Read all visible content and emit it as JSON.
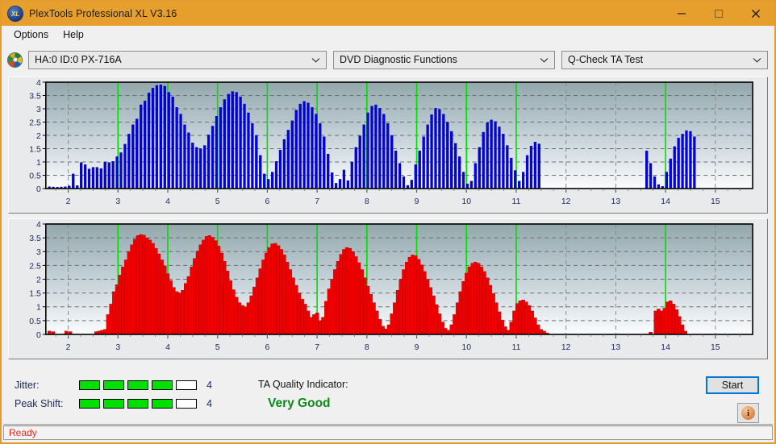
{
  "window": {
    "title": "PlexTools Professional XL V3.16",
    "app_icon": "xl-disc-icon",
    "minimize_label": "minimize-icon",
    "maximize_label": "maximize-icon",
    "close_label": "close-icon"
  },
  "menu": {
    "items": [
      {
        "label": "Options"
      },
      {
        "label": "Help"
      }
    ]
  },
  "selectors": {
    "drive_icon": "disc-drive-icon",
    "drive": "HA:0 ID:0  PX-716A",
    "function": "DVD Diagnostic Functions",
    "test": "Q-Check TA Test"
  },
  "meters": {
    "jitter": {
      "label": "Jitter:",
      "value": "4",
      "filled": 4,
      "total": 5
    },
    "peak_shift": {
      "label": "Peak Shift:",
      "value": "4",
      "filled": 4,
      "total": 5
    },
    "on_color": "#00e000"
  },
  "quality": {
    "label": "TA Quality Indicator:",
    "value": "Very Good",
    "value_color": "#0a8a18"
  },
  "actions": {
    "start_label": "Start",
    "info_label": "i"
  },
  "statusbar": {
    "text": "Ready",
    "text_color": "#e02b20"
  },
  "chart_data": [
    {
      "id": "jitter",
      "type": "bar",
      "title": "",
      "xlabel": "",
      "ylabel": "",
      "series_color": "#0000ee",
      "bar_edge_color": "#000080",
      "xlim": [
        1.55,
        15.75
      ],
      "ylim": [
        0,
        4
      ],
      "yticks": [
        0,
        0.5,
        1,
        1.5,
        2,
        2.5,
        3,
        3.5,
        4
      ],
      "ytick_labels": [
        "0",
        "0.5",
        "1",
        "1.5",
        "2",
        "2.5",
        "3",
        "3.5",
        "4"
      ],
      "xticks": [
        2,
        3,
        4,
        5,
        6,
        7,
        8,
        9,
        10,
        11,
        12,
        13,
        14,
        15
      ],
      "xtick_labels": [
        "2",
        "3",
        "4",
        "5",
        "6",
        "7",
        "8",
        "9",
        "10",
        "11",
        "12",
        "13",
        "14",
        "15"
      ],
      "grid": true,
      "marker_color": "#00dd00",
      "markers": [
        3,
        4,
        5,
        6,
        7,
        8,
        9,
        10,
        11,
        14
      ],
      "bar_gap_ratio": 0.42,
      "x": [
        1.62,
        1.7,
        1.78,
        1.86,
        1.94,
        2.02,
        2.1,
        2.18,
        2.26,
        2.34,
        2.42,
        2.5,
        2.58,
        2.66,
        2.74,
        2.82,
        2.9,
        2.98,
        3.06,
        3.14,
        3.22,
        3.3,
        3.38,
        3.46,
        3.54,
        3.62,
        3.7,
        3.78,
        3.86,
        3.94,
        4.02,
        4.1,
        4.18,
        4.26,
        4.34,
        4.42,
        4.5,
        4.58,
        4.66,
        4.74,
        4.82,
        4.9,
        4.98,
        5.06,
        5.14,
        5.22,
        5.3,
        5.38,
        5.46,
        5.54,
        5.62,
        5.7,
        5.78,
        5.86,
        5.94,
        6.02,
        6.1,
        6.18,
        6.26,
        6.34,
        6.42,
        6.5,
        6.58,
        6.66,
        6.74,
        6.82,
        6.9,
        6.98,
        7.06,
        7.14,
        7.22,
        7.3,
        7.38,
        7.46,
        7.54,
        7.62,
        7.7,
        7.78,
        7.86,
        7.94,
        8.02,
        8.1,
        8.18,
        8.26,
        8.34,
        8.42,
        8.5,
        8.58,
        8.66,
        8.74,
        8.82,
        8.9,
        8.98,
        9.06,
        9.14,
        9.22,
        9.3,
        9.38,
        9.46,
        9.54,
        9.62,
        9.7,
        9.78,
        9.86,
        9.94,
        10.02,
        10.1,
        10.18,
        10.26,
        10.34,
        10.42,
        10.5,
        10.58,
        10.66,
        10.74,
        10.82,
        10.9,
        10.98,
        11.06,
        11.14,
        11.22,
        11.3,
        11.38,
        11.46,
        13.62,
        13.7,
        13.78,
        13.86,
        13.94,
        14.02,
        14.1,
        14.18,
        14.26,
        14.34,
        14.42,
        14.5,
        14.58
      ],
      "values": [
        0.07,
        0.06,
        0.05,
        0.06,
        0.07,
        0.1,
        0.55,
        0.11,
        0.98,
        0.9,
        0.74,
        0.8,
        0.8,
        0.75,
        1.0,
        0.98,
        1.02,
        1.2,
        1.35,
        1.67,
        2.05,
        2.4,
        2.62,
        3.15,
        3.3,
        3.6,
        3.78,
        3.88,
        3.9,
        3.85,
        3.62,
        3.45,
        3.05,
        2.8,
        2.4,
        2.1,
        1.72,
        1.55,
        1.5,
        1.62,
        2.02,
        2.35,
        2.72,
        3.05,
        3.35,
        3.55,
        3.65,
        3.62,
        3.45,
        3.18,
        2.85,
        2.45,
        2.0,
        1.25,
        0.55,
        0.35,
        0.62,
        1.02,
        1.45,
        1.85,
        2.2,
        2.55,
        2.95,
        3.18,
        3.28,
        3.22,
        3.05,
        2.8,
        2.45,
        1.95,
        1.3,
        0.6,
        0.2,
        0.35,
        0.7,
        0.3,
        1.0,
        1.55,
        1.98,
        2.4,
        2.85,
        3.1,
        3.15,
        3.02,
        2.8,
        2.45,
        2.0,
        1.42,
        0.95,
        0.45,
        0.12,
        0.32,
        0.9,
        1.42,
        1.95,
        2.4,
        2.78,
        3.02,
        2.98,
        2.8,
        2.5,
        2.15,
        1.7,
        1.2,
        0.62,
        0.18,
        0.28,
        0.95,
        1.55,
        2.12,
        2.48,
        2.58,
        2.52,
        2.32,
        2.05,
        1.62,
        1.15,
        0.68,
        0.28,
        0.62,
        1.25,
        1.6,
        1.75,
        1.68,
        1.42,
        0.95,
        0.45,
        0.15,
        0.08,
        0.62,
        1.12,
        1.58,
        1.9,
        2.05,
        2.18,
        2.15,
        1.95,
        1.55,
        0.95,
        0.35,
        0.1
      ]
    },
    {
      "id": "peak_shift",
      "type": "bar",
      "title": "",
      "xlabel": "",
      "ylabel": "",
      "series_color": "#ee0000",
      "bar_edge_color": "#aa0000",
      "xlim": [
        1.55,
        15.75
      ],
      "ylim": [
        0,
        4
      ],
      "yticks": [
        0,
        0.5,
        1,
        1.5,
        2,
        2.5,
        3,
        3.5,
        4
      ],
      "ytick_labels": [
        "0",
        "0.5",
        "1",
        "1.5",
        "2",
        "2.5",
        "3",
        "3.5",
        "4"
      ],
      "xticks": [
        2,
        3,
        4,
        5,
        6,
        7,
        8,
        9,
        10,
        11,
        12,
        13,
        14,
        15
      ],
      "xtick_labels": [
        "2",
        "3",
        "4",
        "5",
        "6",
        "7",
        "8",
        "9",
        "10",
        "11",
        "12",
        "13",
        "14",
        "15"
      ],
      "grid": true,
      "marker_color": "#00dd00",
      "markers": [
        3,
        4,
        5,
        6,
        7,
        8,
        9,
        10,
        11,
        14
      ],
      "bar_gap_ratio": 0.18,
      "x": [
        1.62,
        1.7,
        1.96,
        2.04,
        2.56,
        2.62,
        2.68,
        2.74,
        2.8,
        2.86,
        2.92,
        2.98,
        3.04,
        3.1,
        3.16,
        3.22,
        3.28,
        3.34,
        3.4,
        3.46,
        3.52,
        3.58,
        3.64,
        3.7,
        3.76,
        3.82,
        3.88,
        3.94,
        4.0,
        4.06,
        4.12,
        4.18,
        4.24,
        4.3,
        4.36,
        4.42,
        4.48,
        4.54,
        4.6,
        4.66,
        4.72,
        4.78,
        4.84,
        4.9,
        4.96,
        5.02,
        5.08,
        5.14,
        5.2,
        5.26,
        5.32,
        5.38,
        5.44,
        5.5,
        5.56,
        5.62,
        5.68,
        5.74,
        5.8,
        5.86,
        5.92,
        5.98,
        6.04,
        6.1,
        6.16,
        6.22,
        6.28,
        6.34,
        6.4,
        6.46,
        6.52,
        6.58,
        6.64,
        6.7,
        6.76,
        6.82,
        6.88,
        6.94,
        7.0,
        7.06,
        7.12,
        7.18,
        7.24,
        7.3,
        7.36,
        7.42,
        7.48,
        7.54,
        7.6,
        7.66,
        7.72,
        7.78,
        7.84,
        7.9,
        7.96,
        8.02,
        8.08,
        8.14,
        8.2,
        8.26,
        8.32,
        8.38,
        8.44,
        8.5,
        8.56,
        8.62,
        8.68,
        8.74,
        8.8,
        8.86,
        8.92,
        8.98,
        9.04,
        9.1,
        9.16,
        9.22,
        9.28,
        9.34,
        9.4,
        9.46,
        9.52,
        9.58,
        9.64,
        9.7,
        9.76,
        9.82,
        9.88,
        9.94,
        10.0,
        10.06,
        10.12,
        10.18,
        10.24,
        10.3,
        10.36,
        10.42,
        10.48,
        10.54,
        10.6,
        10.66,
        10.72,
        10.78,
        10.84,
        10.9,
        10.96,
        11.02,
        11.08,
        11.14,
        11.2,
        11.26,
        11.32,
        11.38,
        11.44,
        11.5,
        11.56,
        11.62,
        13.7,
        13.8,
        13.86,
        13.92,
        13.98,
        14.04,
        14.1,
        14.16,
        14.22,
        14.28,
        14.34,
        14.4,
        14.46,
        14.52
      ],
      "values": [
        0.12,
        0.1,
        0.12,
        0.1,
        0.1,
        0.12,
        0.15,
        0.18,
        0.72,
        1.1,
        1.55,
        1.8,
        2.15,
        2.45,
        2.7,
        3.0,
        3.25,
        3.45,
        3.58,
        3.62,
        3.6,
        3.5,
        3.42,
        3.3,
        3.12,
        2.92,
        2.7,
        2.48,
        2.2,
        1.95,
        1.7,
        1.55,
        1.5,
        1.6,
        1.85,
        2.1,
        2.45,
        2.75,
        3.02,
        3.25,
        3.42,
        3.55,
        3.58,
        3.52,
        3.4,
        3.2,
        2.95,
        2.65,
        2.3,
        1.95,
        1.62,
        1.35,
        1.15,
        1.05,
        1.0,
        1.15,
        1.4,
        1.72,
        2.05,
        2.38,
        2.7,
        2.95,
        3.15,
        3.28,
        3.3,
        3.22,
        3.08,
        2.88,
        2.62,
        2.35,
        2.05,
        1.78,
        1.5,
        1.28,
        1.1,
        0.85,
        0.62,
        0.72,
        0.78,
        0.5,
        0.62,
        1.2,
        1.65,
        2.0,
        2.35,
        2.65,
        2.9,
        3.08,
        3.15,
        3.12,
        3.0,
        2.82,
        2.6,
        2.35,
        2.05,
        1.75,
        1.45,
        1.15,
        0.85,
        0.55,
        0.3,
        0.2,
        0.35,
        0.75,
        1.15,
        1.6,
        2.0,
        2.35,
        2.62,
        2.8,
        2.88,
        2.85,
        2.72,
        2.52,
        2.28,
        2.0,
        1.7,
        1.4,
        1.08,
        0.75,
        0.45,
        0.22,
        0.15,
        0.35,
        0.72,
        1.15,
        1.55,
        1.92,
        2.22,
        2.45,
        2.58,
        2.62,
        2.58,
        2.45,
        2.28,
        2.05,
        1.78,
        1.48,
        1.15,
        0.82,
        0.52,
        0.28,
        0.15,
        0.45,
        0.85,
        1.12,
        1.22,
        1.25,
        1.18,
        1.05,
        0.85,
        0.6,
        0.35,
        0.18,
        0.12,
        0.05,
        0.08,
        0.85,
        0.92,
        0.85,
        0.95,
        1.18,
        1.22,
        1.1,
        0.9,
        0.65,
        0.35,
        0.12
      ]
    }
  ]
}
